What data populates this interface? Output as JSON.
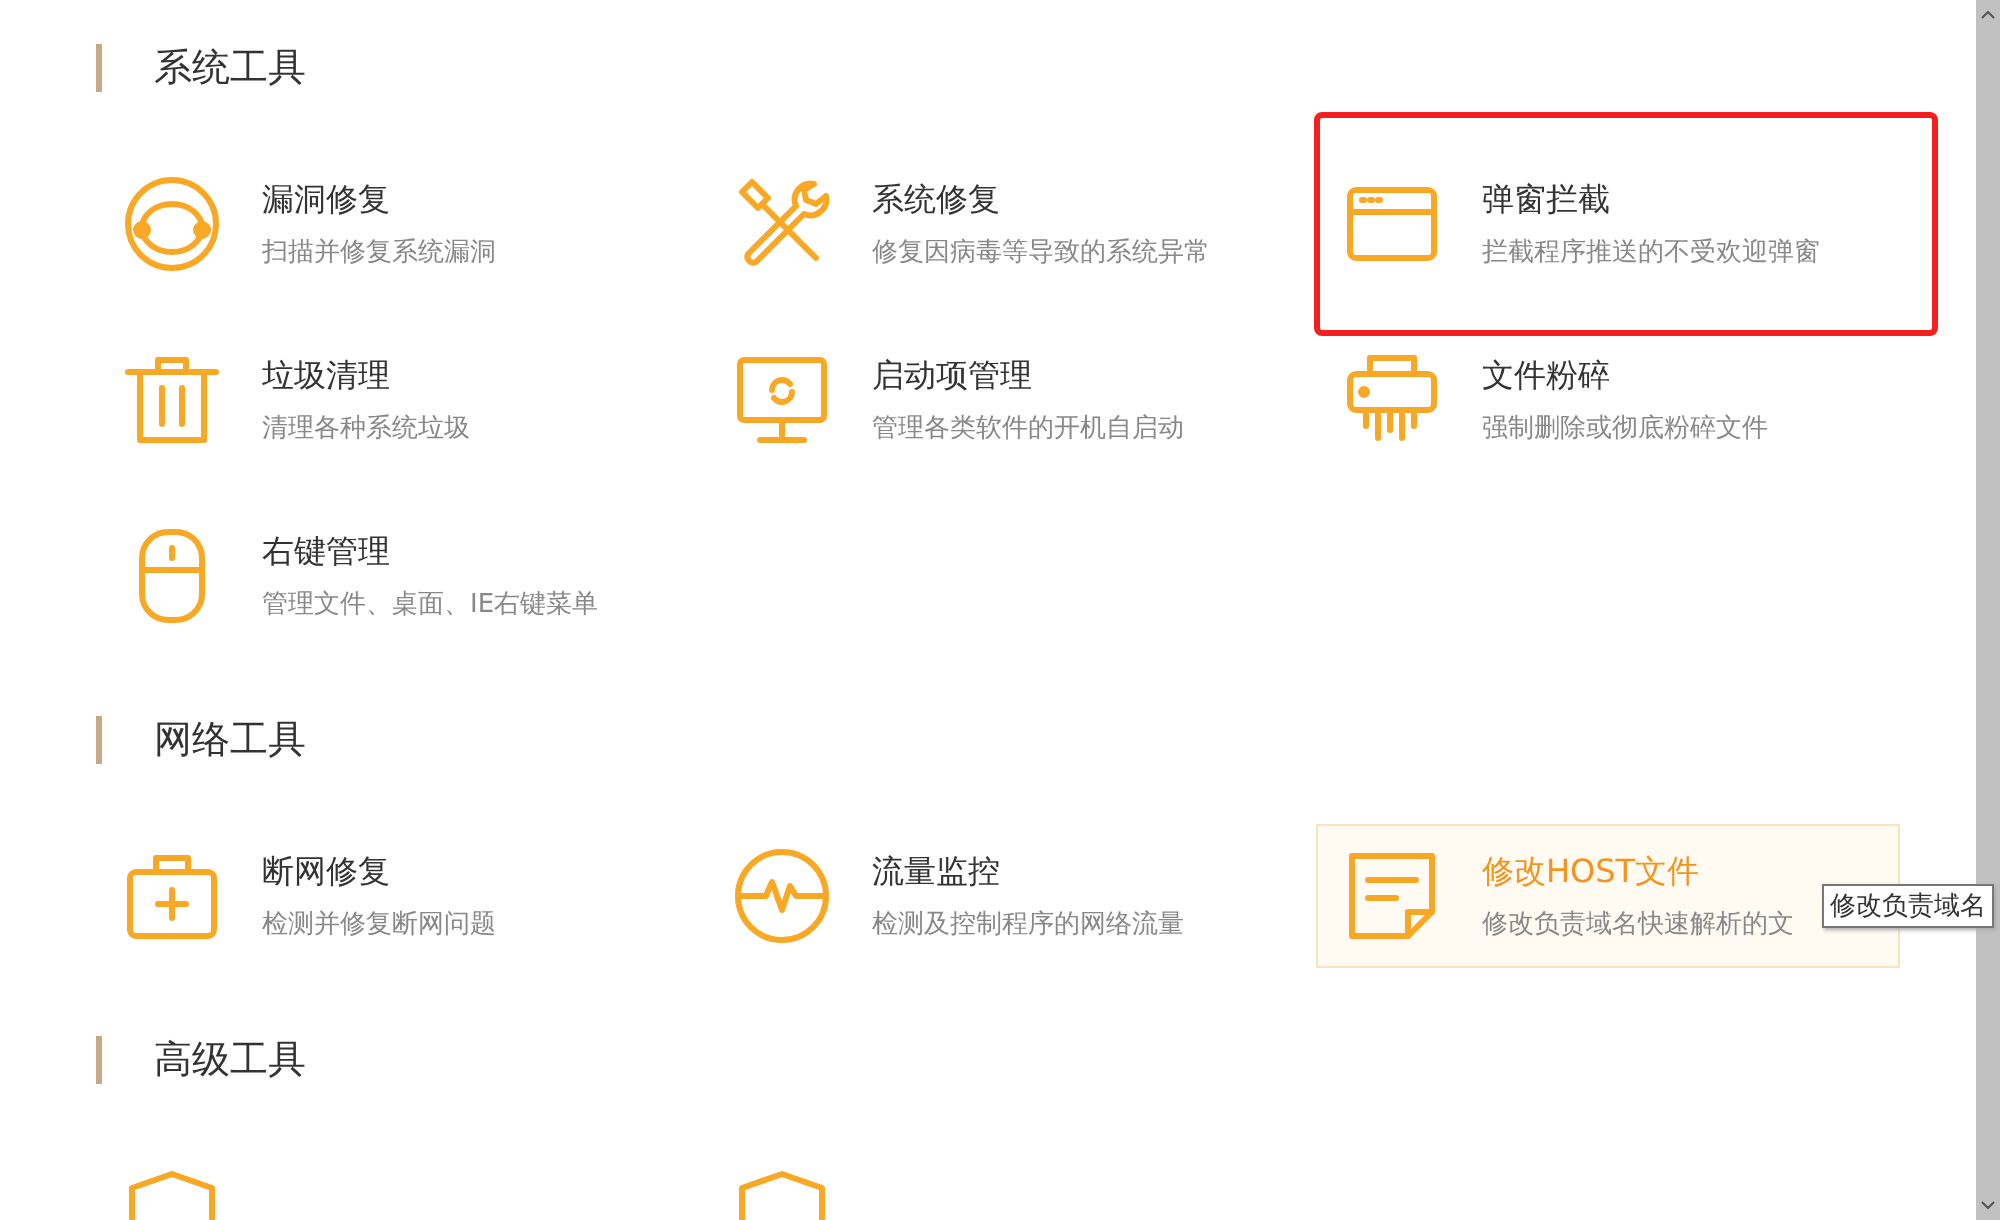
{
  "sections": [
    {
      "title": "系统工具",
      "items": [
        {
          "kind": "bug",
          "title": "漏洞修复",
          "desc": "扫描并修复系统漏洞",
          "hovered": false,
          "highlighted": false
        },
        {
          "kind": "tools",
          "title": "系统修复",
          "desc": "修复因病毒等导致的系统异常",
          "hovered": false,
          "highlighted": false
        },
        {
          "kind": "popup",
          "title": "弹窗拦截",
          "desc": "拦截程序推送的不受欢迎弹窗",
          "hovered": false,
          "highlighted": true
        },
        {
          "kind": "trash",
          "title": "垃圾清理",
          "desc": "清理各种系统垃圾",
          "hovered": false,
          "highlighted": false
        },
        {
          "kind": "monitor",
          "title": "启动项管理",
          "desc": "管理各类软件的开机自启动",
          "hovered": false,
          "highlighted": false
        },
        {
          "kind": "shredder",
          "title": "文件粉碎",
          "desc": "强制删除或彻底粉碎文件",
          "hovered": false,
          "highlighted": false
        },
        {
          "kind": "mouse",
          "title": "右键管理",
          "desc": "管理文件、桌面、IE右键菜单",
          "hovered": false,
          "highlighted": false
        }
      ]
    },
    {
      "title": "网络工具",
      "items": [
        {
          "kind": "kit",
          "title": "断网修复",
          "desc": "检测并修复断网问题",
          "hovered": false,
          "highlighted": false
        },
        {
          "kind": "pulse",
          "title": "流量监控",
          "desc": "检测及控制程序的网络流量",
          "hovered": false,
          "highlighted": false
        },
        {
          "kind": "note",
          "title": "修改HOST文件",
          "desc": "修改负责域名快速解析的文",
          "hovered": true,
          "highlighted": false,
          "tooltip": "修改负责域名"
        }
      ]
    },
    {
      "title": "高级工具",
      "items": [
        {
          "kind": "shield",
          "hovered": false,
          "highlighted": false
        },
        {
          "kind": "shield",
          "hovered": false,
          "highlighted": false
        }
      ]
    }
  ]
}
